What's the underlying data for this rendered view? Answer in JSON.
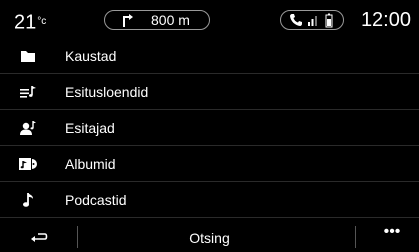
{
  "status": {
    "temperature": "21",
    "temperature_unit": "°c",
    "nav_distance": "800 m",
    "clock": "12:00"
  },
  "menu": {
    "items": [
      {
        "label": "Kaustad",
        "icon": "folder-icon"
      },
      {
        "label": "Esitusloendid",
        "icon": "playlist-icon"
      },
      {
        "label": "Esitajad",
        "icon": "artists-icon"
      },
      {
        "label": "Albumid",
        "icon": "albums-icon"
      },
      {
        "label": "Podcastid",
        "icon": "music-note-icon"
      }
    ]
  },
  "bottom": {
    "search_label": "Otsing",
    "more_label": "•••"
  },
  "colors": {
    "background": "#000000",
    "text": "#ffffff",
    "pill_border": "#9a9a9a",
    "divider": "#2a2a2a"
  }
}
